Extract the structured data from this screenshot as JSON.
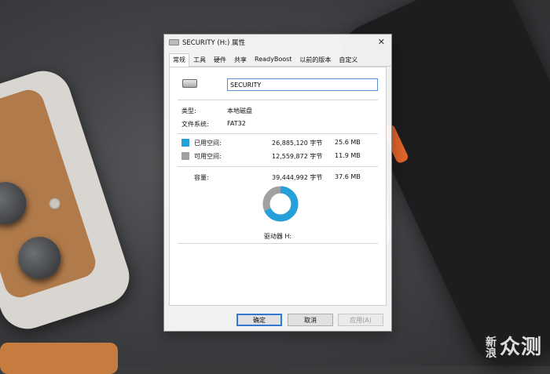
{
  "window": {
    "title": "SECURITY (H:) 属性",
    "close_glyph": "✕"
  },
  "tabs": [
    {
      "label": "常规",
      "active": true
    },
    {
      "label": "工具",
      "active": false
    },
    {
      "label": "硬件",
      "active": false
    },
    {
      "label": "共享",
      "active": false
    },
    {
      "label": "ReadyBoost",
      "active": false
    },
    {
      "label": "以前的版本",
      "active": false
    },
    {
      "label": "自定义",
      "active": false
    }
  ],
  "general": {
    "drive_name": "SECURITY",
    "type_label": "类型:",
    "type_value": "本地磁盘",
    "fs_label": "文件系统:",
    "fs_value": "FAT32",
    "used": {
      "label": "已用空间:",
      "bytes": "26,885,120 字节",
      "size": "25.6 MB",
      "color": "#26a0da"
    },
    "free": {
      "label": "可用空间:",
      "bytes": "12,559,872 字节",
      "size": "11.9 MB",
      "color": "#a0a0a0"
    },
    "capacity": {
      "label": "容量:",
      "bytes": "39,444,992 字节",
      "size": "37.6 MB"
    },
    "drive_label": "驱动器 H:",
    "used_fraction": 0.682
  },
  "buttons": {
    "ok": "确定",
    "cancel": "取消",
    "apply": "应用(A)"
  },
  "watermark": {
    "small": "新浪",
    "big": "众测"
  }
}
